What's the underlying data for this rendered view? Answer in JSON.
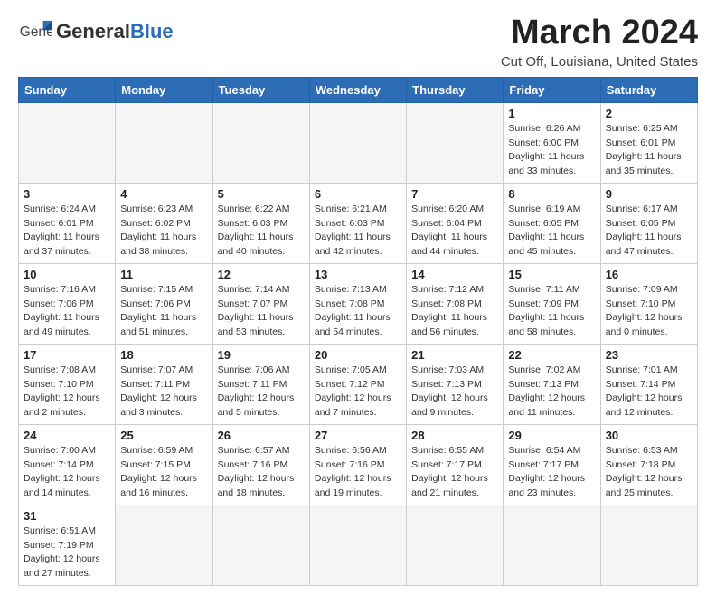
{
  "logo": {
    "text_general": "General",
    "text_blue": "Blue"
  },
  "title": "March 2024",
  "location": "Cut Off, Louisiana, United States",
  "weekdays": [
    "Sunday",
    "Monday",
    "Tuesday",
    "Wednesday",
    "Thursday",
    "Friday",
    "Saturday"
  ],
  "weeks": [
    [
      {
        "day": "",
        "info": ""
      },
      {
        "day": "",
        "info": ""
      },
      {
        "day": "",
        "info": ""
      },
      {
        "day": "",
        "info": ""
      },
      {
        "day": "",
        "info": ""
      },
      {
        "day": "1",
        "info": "Sunrise: 6:26 AM\nSunset: 6:00 PM\nDaylight: 11 hours\nand 33 minutes."
      },
      {
        "day": "2",
        "info": "Sunrise: 6:25 AM\nSunset: 6:01 PM\nDaylight: 11 hours\nand 35 minutes."
      }
    ],
    [
      {
        "day": "3",
        "info": "Sunrise: 6:24 AM\nSunset: 6:01 PM\nDaylight: 11 hours\nand 37 minutes."
      },
      {
        "day": "4",
        "info": "Sunrise: 6:23 AM\nSunset: 6:02 PM\nDaylight: 11 hours\nand 38 minutes."
      },
      {
        "day": "5",
        "info": "Sunrise: 6:22 AM\nSunset: 6:03 PM\nDaylight: 11 hours\nand 40 minutes."
      },
      {
        "day": "6",
        "info": "Sunrise: 6:21 AM\nSunset: 6:03 PM\nDaylight: 11 hours\nand 42 minutes."
      },
      {
        "day": "7",
        "info": "Sunrise: 6:20 AM\nSunset: 6:04 PM\nDaylight: 11 hours\nand 44 minutes."
      },
      {
        "day": "8",
        "info": "Sunrise: 6:19 AM\nSunset: 6:05 PM\nDaylight: 11 hours\nand 45 minutes."
      },
      {
        "day": "9",
        "info": "Sunrise: 6:17 AM\nSunset: 6:05 PM\nDaylight: 11 hours\nand 47 minutes."
      }
    ],
    [
      {
        "day": "10",
        "info": "Sunrise: 7:16 AM\nSunset: 7:06 PM\nDaylight: 11 hours\nand 49 minutes."
      },
      {
        "day": "11",
        "info": "Sunrise: 7:15 AM\nSunset: 7:06 PM\nDaylight: 11 hours\nand 51 minutes."
      },
      {
        "day": "12",
        "info": "Sunrise: 7:14 AM\nSunset: 7:07 PM\nDaylight: 11 hours\nand 53 minutes."
      },
      {
        "day": "13",
        "info": "Sunrise: 7:13 AM\nSunset: 7:08 PM\nDaylight: 11 hours\nand 54 minutes."
      },
      {
        "day": "14",
        "info": "Sunrise: 7:12 AM\nSunset: 7:08 PM\nDaylight: 11 hours\nand 56 minutes."
      },
      {
        "day": "15",
        "info": "Sunrise: 7:11 AM\nSunset: 7:09 PM\nDaylight: 11 hours\nand 58 minutes."
      },
      {
        "day": "16",
        "info": "Sunrise: 7:09 AM\nSunset: 7:10 PM\nDaylight: 12 hours\nand 0 minutes."
      }
    ],
    [
      {
        "day": "17",
        "info": "Sunrise: 7:08 AM\nSunset: 7:10 PM\nDaylight: 12 hours\nand 2 minutes."
      },
      {
        "day": "18",
        "info": "Sunrise: 7:07 AM\nSunset: 7:11 PM\nDaylight: 12 hours\nand 3 minutes."
      },
      {
        "day": "19",
        "info": "Sunrise: 7:06 AM\nSunset: 7:11 PM\nDaylight: 12 hours\nand 5 minutes."
      },
      {
        "day": "20",
        "info": "Sunrise: 7:05 AM\nSunset: 7:12 PM\nDaylight: 12 hours\nand 7 minutes."
      },
      {
        "day": "21",
        "info": "Sunrise: 7:03 AM\nSunset: 7:13 PM\nDaylight: 12 hours\nand 9 minutes."
      },
      {
        "day": "22",
        "info": "Sunrise: 7:02 AM\nSunset: 7:13 PM\nDaylight: 12 hours\nand 11 minutes."
      },
      {
        "day": "23",
        "info": "Sunrise: 7:01 AM\nSunset: 7:14 PM\nDaylight: 12 hours\nand 12 minutes."
      }
    ],
    [
      {
        "day": "24",
        "info": "Sunrise: 7:00 AM\nSunset: 7:14 PM\nDaylight: 12 hours\nand 14 minutes."
      },
      {
        "day": "25",
        "info": "Sunrise: 6:59 AM\nSunset: 7:15 PM\nDaylight: 12 hours\nand 16 minutes."
      },
      {
        "day": "26",
        "info": "Sunrise: 6:57 AM\nSunset: 7:16 PM\nDaylight: 12 hours\nand 18 minutes."
      },
      {
        "day": "27",
        "info": "Sunrise: 6:56 AM\nSunset: 7:16 PM\nDaylight: 12 hours\nand 19 minutes."
      },
      {
        "day": "28",
        "info": "Sunrise: 6:55 AM\nSunset: 7:17 PM\nDaylight: 12 hours\nand 21 minutes."
      },
      {
        "day": "29",
        "info": "Sunrise: 6:54 AM\nSunset: 7:17 PM\nDaylight: 12 hours\nand 23 minutes."
      },
      {
        "day": "30",
        "info": "Sunrise: 6:53 AM\nSunset: 7:18 PM\nDaylight: 12 hours\nand 25 minutes."
      }
    ],
    [
      {
        "day": "31",
        "info": "Sunrise: 6:51 AM\nSunset: 7:19 PM\nDaylight: 12 hours\nand 27 minutes."
      },
      {
        "day": "",
        "info": ""
      },
      {
        "day": "",
        "info": ""
      },
      {
        "day": "",
        "info": ""
      },
      {
        "day": "",
        "info": ""
      },
      {
        "day": "",
        "info": ""
      },
      {
        "day": "",
        "info": ""
      }
    ]
  ]
}
